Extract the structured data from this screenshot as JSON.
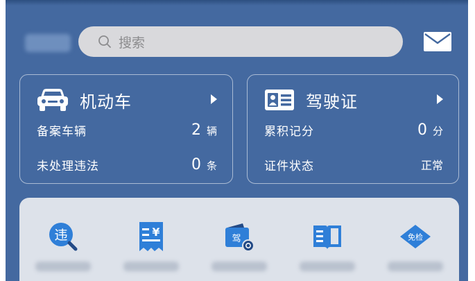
{
  "search": {
    "placeholder": "搜索"
  },
  "vehicle_card": {
    "title": "机动车",
    "rows": [
      {
        "label": "备案车辆",
        "value": "2",
        "unit": "辆"
      },
      {
        "label": "未处理违法",
        "value": "0",
        "unit": "条"
      }
    ]
  },
  "license_card": {
    "title": "驾驶证",
    "rows": [
      {
        "label": "累积记分",
        "value": "0",
        "unit": "分"
      },
      {
        "label": "证件状态",
        "value": "正常"
      }
    ]
  },
  "services": [
    {
      "icon": "violation-icon",
      "glyph": "违"
    },
    {
      "icon": "payment-receipt-icon",
      "glyph": "¥"
    },
    {
      "icon": "license-wallet-icon",
      "glyph": "驾"
    },
    {
      "icon": "open-book-icon"
    },
    {
      "icon": "inspection-exempt-icon",
      "glyph": "免检"
    }
  ],
  "colors": {
    "background": "#4469a0",
    "card_border": "#ffffff",
    "panel": "#dde2ea",
    "icon_blue": "#2f7fd8",
    "icon_dark": "#234a86"
  }
}
